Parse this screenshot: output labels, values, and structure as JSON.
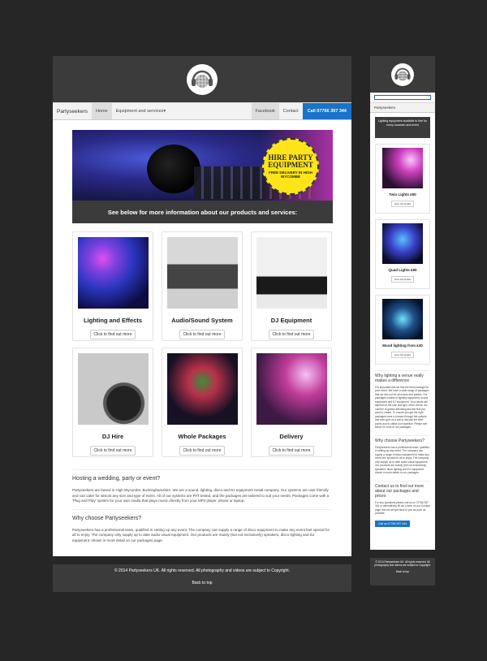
{
  "desktop": {
    "nav": {
      "brand": "Partyseekers",
      "home": "Home",
      "equipment": "Equipment and services",
      "facebook": "Facebook",
      "contact": "Contact",
      "call": "Call 07766 397 344"
    },
    "hero": {
      "badge_title": "HIRE PARTY EQUIPMENT",
      "badge_sub": "FREE DELIVERY IN HIGH WYCOMBE",
      "caption": "See below for more information about our products and services:"
    },
    "cards": [
      {
        "title": "Lighting and Effects",
        "button": "Click to find out more"
      },
      {
        "title": "Audio/Sound System",
        "button": "Click to find out more"
      },
      {
        "title": "DJ Equipment",
        "button": "Click to find out more"
      },
      {
        "title": "DJ Hire",
        "button": "Click to find out more"
      },
      {
        "title": "Whole Packages",
        "button": "Click to find out more"
      },
      {
        "title": "Delivery",
        "button": "Click to find out more"
      }
    ],
    "sections": {
      "h1": "Hosting a wedding, party or event?",
      "p1": "Partyseekers are based in High Wycombe, Buckinghamshire. We are a sound, lighting, disco and DJ equipment rental company. Our systems are user friendly and can cater for almost any size and type of event. All of our systems are PAT tested, and the packages are tailored to suit your needs. Packages come with a 'Plug and Play' system for your own media that plays music directly from your MP3 player, phone or laptop.",
      "h2": "Why choose Partyseekers?",
      "p2": "Partyseekers has a professional team, qualified in setting up any event. The company can supply a range of disco equipment to make any event feel special for all to enjoy. The company only supply up to date audio visual equipment. Our products are mainly (but not exclusively) speakers, disco lighting and DJ equipment, shown in more detail on our packages page."
    },
    "footer": {
      "copyright": "© 2014 Partyseekers UK. All rights reserved. All photography and videos are subject to Copyright.",
      "back": "Back to top"
    }
  },
  "mobile": {
    "brand": "Partyseekers",
    "banner": "Lighting equipment available to hire for every occasion and event",
    "cards": [
      {
        "title": "Twin Lights £60",
        "button": "View full details"
      },
      {
        "title": "Quad Lights £80",
        "button": "View full details"
      },
      {
        "title": "Mood lighting from £40",
        "button": "View full details"
      }
    ],
    "h1": "Why lighting a venue really makes a difference",
    "p1": "It is important that we find the best package for your event. We have a wide range of packages that we hire out for all events and parties. Our packages consist of lighting equipment, sound equipment and DJ equipment. Your needs will depend on the size and type of the venue, the number of guests attending and the feel you want to create. To ensure you get the right packages have a browse through the options and then give us a call to discuss the finer points and to utilise our expertise. Please see below for a list of our packages.",
    "h2": "Why choose Partyseekers?",
    "p2": "Partyseekers has a professional team, qualified in setting up any event. The company can supply a range of disco equipment to make any event feel special for all to enjoy. The company only supply up to date audio visual equipment. Our products are mainly (but not exclusively) speakers, disco lighting and DJ equipment, shown in more detail on our packages.",
    "h3": "Contact us to find out more about our packages and prices",
    "p3": "For any questions please call us on 07766 397 344 or alternatively fill out a form on our Contact page and we will get back to you as soon as possible.",
    "cta": "Call us 07766 397 344",
    "footer": "© 2014 Partyseekers UK. All rights reserved. All photography and videos are subject to Copyright.",
    "back": "Back to top"
  }
}
